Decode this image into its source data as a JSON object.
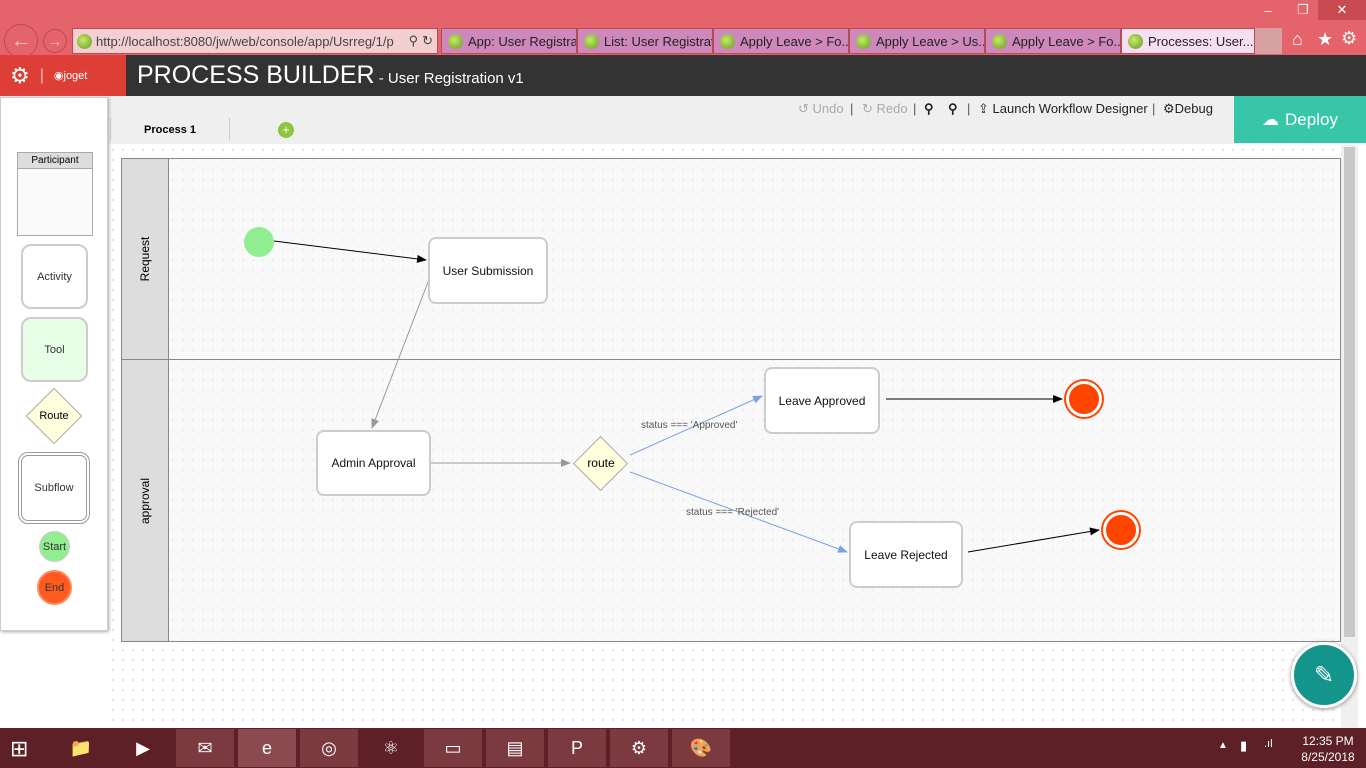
{
  "browser": {
    "url": "http://localhost:8080/jw/web/console/app/Usrreg/1/p",
    "tabs": [
      "App: User Registra...",
      "List: User Registrati...",
      "Apply Leave  >  Fo...",
      "Apply Leave  >  Us...",
      "Apply Leave  >  Fo...",
      "Processes: User..."
    ],
    "close": "×"
  },
  "app": {
    "brand": "joget",
    "title": "PROCESS BUILDER",
    "subtitle": " - User Registration v1"
  },
  "toolbar": {
    "undo": "Undo",
    "redo": "Redo",
    "launch": "Launch Workflow Designer",
    "debug": "Debug",
    "deploy": "Deploy",
    "process_tab": "Process 1"
  },
  "palette": {
    "participant": "Participant",
    "activity": "Activity",
    "tool": "Tool",
    "route": "Route",
    "subflow": "Subflow",
    "start": "Start",
    "end": "End"
  },
  "lanes": [
    "Request",
    "approval"
  ],
  "nodes": {
    "user_submission": "User Submission",
    "admin_approval": "Admin Approval",
    "route": "route",
    "leave_approved": "Leave Approved",
    "leave_rejected": "Leave Rejected"
  },
  "transitions": {
    "approved": "status === 'Approved'",
    "rejected": "status === 'Rejected'"
  },
  "taskbar": {
    "time": "12:35 PM",
    "date": "8/25/2018"
  }
}
